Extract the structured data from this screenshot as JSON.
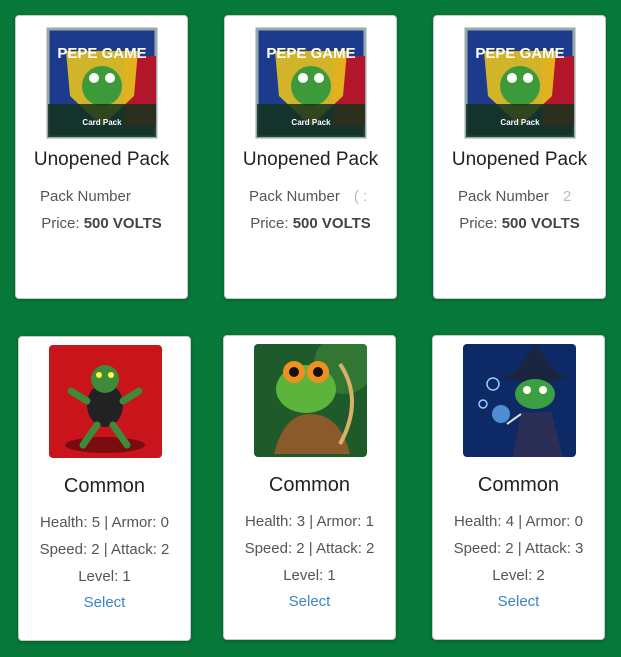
{
  "packs": [
    {
      "image_text_top": "PEPE GAME",
      "image_text_bottom": "Card Pack",
      "title": "Unopened Pack",
      "number_label": "Pack Number",
      "number_value": "",
      "price_label": "Price:",
      "price_value": "500 VOLTS"
    },
    {
      "image_text_top": "PEPE GAME",
      "image_text_bottom": "Card Pack",
      "title": "Unopened Pack",
      "number_label": "Pack Number",
      "number_value": "( :",
      "price_label": "Price:",
      "price_value": "500 VOLTS"
    },
    {
      "image_text_top": "PEPE GAME",
      "image_text_bottom": "Card Pack",
      "title": "Unopened Pack",
      "number_label": "Pack Number",
      "number_value": "2",
      "price_label": "Price:",
      "price_value": "500 VOLTS"
    }
  ],
  "cards": [
    {
      "title": "Common",
      "health": "Health: 5 | Armor: 0",
      "speed": "Speed: 2 | Attack: 2",
      "level": "Level: 1",
      "select": "Select",
      "image": "fighter-frog"
    },
    {
      "title": "Common",
      "health": "Health: 3 | Armor: 1",
      "speed": "Speed: 2 | Attack: 2",
      "level": "Level: 1",
      "select": "Select",
      "image": "archer-frog"
    },
    {
      "title": "Common",
      "health": "Health: 4 | Armor: 0",
      "speed": "Speed: 2 | Attack: 3",
      "level": "Level: 2",
      "select": "Select",
      "image": "wizard-frog"
    }
  ],
  "colors": {
    "background": "#06783a",
    "link": "#3a85c4"
  }
}
